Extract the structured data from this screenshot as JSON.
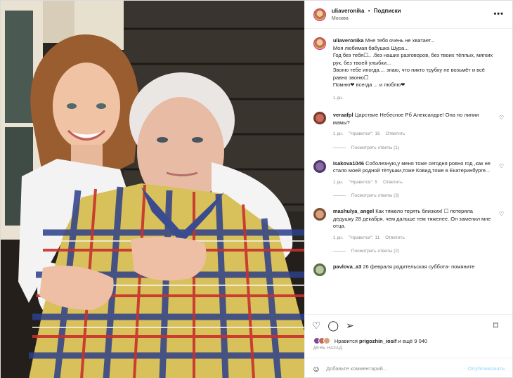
{
  "photo": {
    "alt_icon": "photo-of-two-women"
  },
  "header": {
    "username": "uliaveronika",
    "separator": "•",
    "follow_label": "Подписки",
    "location": "Москва",
    "more_icon": "more-icon"
  },
  "caption": {
    "username": "uliaveronika",
    "lines": [
      "Мне тебя очень не хватает...",
      "Моя любимая бабушка Шура...",
      "Год без тебя☐.. .без наших разговоров, без твоих тёплых, мягких рук, без твоей улыбки...",
      "Звоню тебе иногда.... знаю, что никто трубку не возьмёт и всё равно звоню☐",
      "Помню❤ всегда ... и люблю❤"
    ],
    "time": "1 дн."
  },
  "comments": [
    {
      "username": "veraafpl",
      "text": "Царствие Небесное Рб Александре! Она по линии мамы?",
      "time": "1 дн.",
      "likes": "\"Нравится\": 16",
      "reply": "Ответить",
      "replies": "Посмотреть ответы (1)"
    },
    {
      "username": "isakova1046",
      "text": "Соболезную,у меня тоже сегодня ровно год ,как не стало моей родной тётушки,тоже Ковид,тоже в Екатеринбурге...",
      "time": "1 дн.",
      "likes": "\"Нравится\": 5",
      "reply": "Ответить",
      "replies": "Посмотреть ответы (3)"
    },
    {
      "username": "mashulya_angel",
      "text": "Как тяжело терять близких! ☐ потеряла дедушку 28 декабря. чем дальше тем тяжелее. Он заменил мне отца.",
      "time": "1 дн.",
      "likes": "\"Нравится\": 11",
      "reply": "Ответить",
      "replies": "Посмотреть ответы (2)"
    },
    {
      "username": "pavlova_a3",
      "text": "26 февраля родительская суббота- помяните",
      "time": "",
      "likes": "",
      "reply": "",
      "replies": ""
    }
  ],
  "actions": {
    "like_icon": "heart-icon",
    "comment_icon": "comment-icon",
    "share_icon": "share-icon",
    "save_icon": "bookmark-icon"
  },
  "likes": {
    "prefix": "Нравится",
    "user": "prigozhin_iosif",
    "suffix": "и ещё 9 040"
  },
  "date": "ДЕНЬ НАЗАД",
  "add_comment": {
    "placeholder": "Добавьте комментарий...",
    "publish": "Опубликовать",
    "emoji_icon": "smile-icon"
  },
  "colors": {
    "accent": "#0095f6",
    "publish_disabled": "#b2dffc",
    "muted": "#8e8e8e"
  }
}
